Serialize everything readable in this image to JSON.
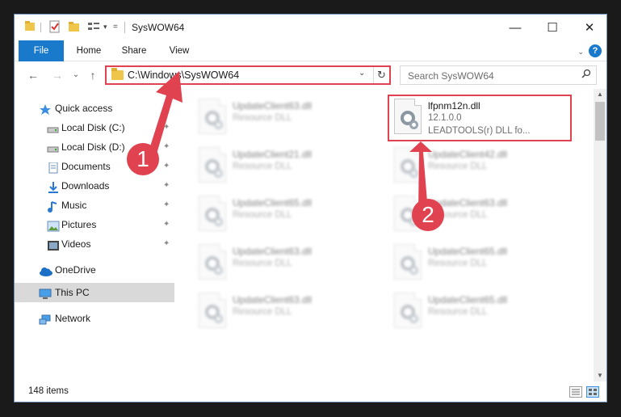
{
  "window": {
    "title": "SysWOW64",
    "controls": {
      "minimize": "—",
      "maximize": "☐",
      "close": "✕"
    }
  },
  "ribbon": {
    "tabs": [
      "File",
      "Home",
      "Share",
      "View"
    ],
    "help": "?"
  },
  "address_bar": {
    "path": "C:\\Windows\\SysWOW64",
    "dropdown_glyph": "⌄",
    "refresh_glyph": "↻"
  },
  "search": {
    "placeholder": "Search SysWOW64",
    "icon": "search-icon"
  },
  "nav": {
    "back": "←",
    "forward": "→",
    "recent": "⌄",
    "up": "↑",
    "items": [
      {
        "label": "Quick access",
        "icon": "star-icon"
      },
      {
        "label": "Local Disk (C:)",
        "icon": "drive-icon",
        "pinned": true
      },
      {
        "label": "Local Disk (D:)",
        "icon": "drive-icon",
        "pinned": true
      },
      {
        "label": "Documents",
        "icon": "documents-icon",
        "pinned": true
      },
      {
        "label": "Downloads",
        "icon": "download-icon",
        "pinned": true
      },
      {
        "label": "Music",
        "icon": "music-icon",
        "pinned": true
      },
      {
        "label": "Pictures",
        "icon": "pictures-icon",
        "pinned": true
      },
      {
        "label": "Videos",
        "icon": "videos-icon",
        "pinned": true
      },
      {
        "label": "OneDrive",
        "icon": "cloud-icon"
      },
      {
        "label": "This PC",
        "icon": "computer-icon",
        "selected": true
      },
      {
        "label": "Network",
        "icon": "network-icon"
      }
    ],
    "pin_glyph": "📌"
  },
  "files": {
    "highlighted": {
      "name": "lfpnm12n.dll",
      "version": "12.1.0.0",
      "description": "LEADTOOLS(r) DLL fo..."
    },
    "left_column": [
      {
        "name": "UpdateClient63.dll",
        "type": "Resource DLL"
      },
      {
        "name": "UpdateClient21.dll",
        "type": "Resource DLL"
      },
      {
        "name": "UpdateClient65.dll",
        "type": "Resource DLL"
      },
      {
        "name": "UpdateClient63.dll",
        "type": "Resource DLL"
      },
      {
        "name": "UpdateClient63.dll",
        "type": "Resource DLL"
      }
    ],
    "right_column": [
      {
        "name": "UpdateClient42.dll",
        "type": "Resource DLL"
      },
      {
        "name": "UpdateClient63.dll",
        "type": "Resource DLL"
      },
      {
        "name": "UpdateClient65.dll",
        "type": "Resource DLL"
      },
      {
        "name": "UpdateClient65.dll",
        "type": "Resource DLL"
      }
    ]
  },
  "status": {
    "item_count": "148 items"
  },
  "annotations": {
    "step1": "1",
    "step2": "2",
    "color": "#e0424f"
  }
}
